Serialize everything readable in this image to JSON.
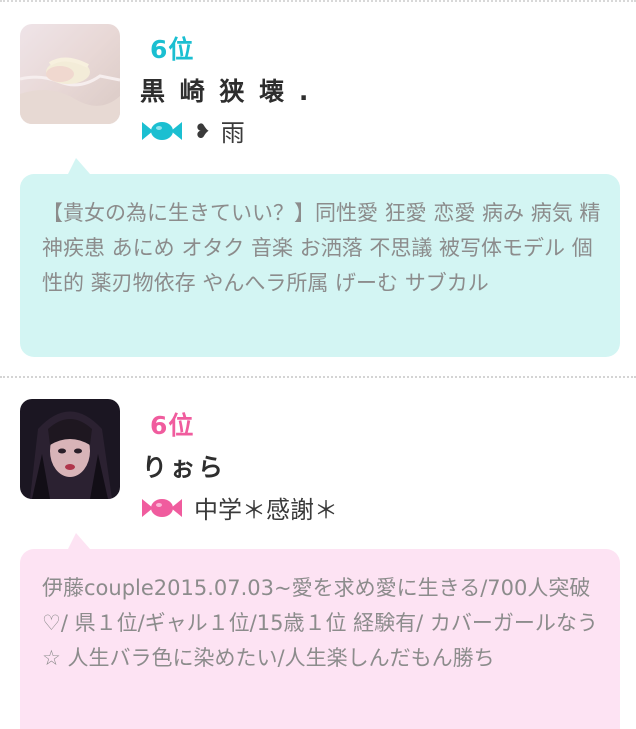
{
  "users": [
    {
      "rank": "6位",
      "name": "黒 崎 狭 壊 .",
      "heart_icon": "❥",
      "status": "雨",
      "candy_icon": "candy-icon",
      "profile": "【貴女の為に生きていい？】同性愛 狂愛 恋愛 病み 病気 精神疾患 あにめ オタク 音楽 お洒落 不思議 被写体モデル 個性的 薬刃物依存 やんへラ所属 げーむ サブカル",
      "accent": "#1bbfd1",
      "bubble_color": "#d3f5f3"
    },
    {
      "rank": "6位",
      "name": "りぉら",
      "status": "中学＊感謝＊",
      "candy_icon": "candy-icon",
      "profile": "伊藤couple2015.07.03~愛を求め愛に生きる/700人突破♡/ 県１位/ギャル１位/15歳１位 経験有/ カバーガールなう☆ 人生バラ色に染めたい/人生楽しんだもん勝ち",
      "accent": "#f05c9e",
      "bubble_color": "#fde3f3"
    }
  ]
}
